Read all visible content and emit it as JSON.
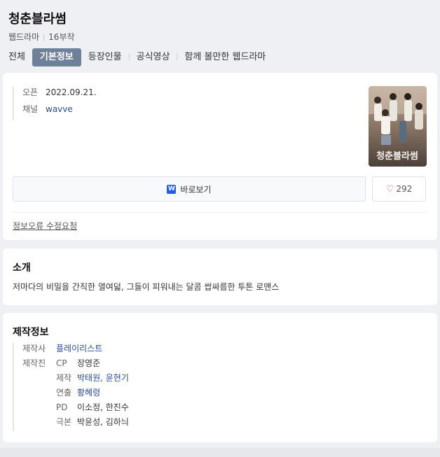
{
  "header": {
    "title": "청춘블라썸",
    "genre": "웹드라마",
    "episodes": "16부작"
  },
  "tabs": [
    {
      "label": "전체",
      "active": false
    },
    {
      "label": "기본정보",
      "active": true
    },
    {
      "label": "등장인물",
      "active": false
    },
    {
      "label": "공식영상",
      "active": false
    },
    {
      "label": "함께 볼만한 웹드라마",
      "active": false
    }
  ],
  "basic": {
    "open_label": "오픈",
    "open_value": "2022.09.21.",
    "channel_label": "채널",
    "channel_value": "wavve",
    "poster_text": "청춘블라썸",
    "watch_icon": "W",
    "watch_label": "바로보기",
    "like_count": "292",
    "report_label": "정보오류 수정요청"
  },
  "intro": {
    "title": "소개",
    "text": "저마다의 비밀을 간직한 열여덟, 그들이 피워내는 달콤 쌉싸름한 투톤 로맨스"
  },
  "production": {
    "title": "제작정보",
    "company_label": "제작사",
    "company_value": "플레이리스트",
    "staff_label": "제작진",
    "staff": [
      {
        "role": "CP",
        "names": "장영준",
        "link": false
      },
      {
        "role": "제작",
        "names": "박태원, 윤현기",
        "link": true
      },
      {
        "role": "연출",
        "names": "황혜령",
        "link": true
      },
      {
        "role": "PD",
        "names": "이소정, 한진수",
        "link": false
      },
      {
        "role": "극본",
        "names": "박윤성, 김하늬",
        "link": false
      }
    ]
  },
  "colors": {
    "active_tab": "#6f8199",
    "link": "#2a4c9b",
    "heart": "#e6494d",
    "wavve": "#1f5dea"
  }
}
